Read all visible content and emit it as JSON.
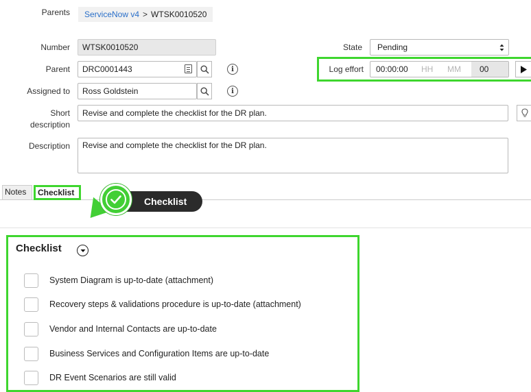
{
  "form": {
    "parents_label": "Parents",
    "breadcrumb": {
      "link": "ServiceNow v4",
      "sep": ">",
      "current": "WTSK0010520"
    },
    "number_label": "Number",
    "number_value": "WTSK0010520",
    "parent_label": "Parent",
    "parent_value": "DRC0001443",
    "assigned_label": "Assigned to",
    "assigned_value": "Ross Goldstein",
    "short_desc_label_1": "Short",
    "short_desc_label_2": "description",
    "short_desc_value": "Revise and complete the checklist for the DR plan.",
    "description_label": "Description",
    "description_value": "Revise and complete the checklist for the DR plan.",
    "state_label": "State",
    "state_value": "Pending",
    "log_effort_label": "Log effort",
    "log_effort_time": "00:00:00",
    "log_effort_hh": "HH",
    "log_effort_mm": "MM",
    "log_effort_ss": "00"
  },
  "tabs": [
    {
      "label": "Notes"
    },
    {
      "label": "Checklist"
    }
  ],
  "tooltip": {
    "label": "Checklist"
  },
  "checklist": {
    "title": "Checklist",
    "items": [
      {
        "label": "System Diagram is up-to-date (attachment)"
      },
      {
        "label": "Recovery steps & validations procedure is up-to-date (attachment)"
      },
      {
        "label": "Vendor and Internal Contacts are up-to-date"
      },
      {
        "label": "Business Services and Configuration Items are up-to-date"
      },
      {
        "label": "DR Event Scenarios are still valid"
      }
    ]
  },
  "colors": {
    "highlight": "#3ed62e",
    "link": "#2a6fc9",
    "tooltip_bg": "#2b2b2b"
  }
}
